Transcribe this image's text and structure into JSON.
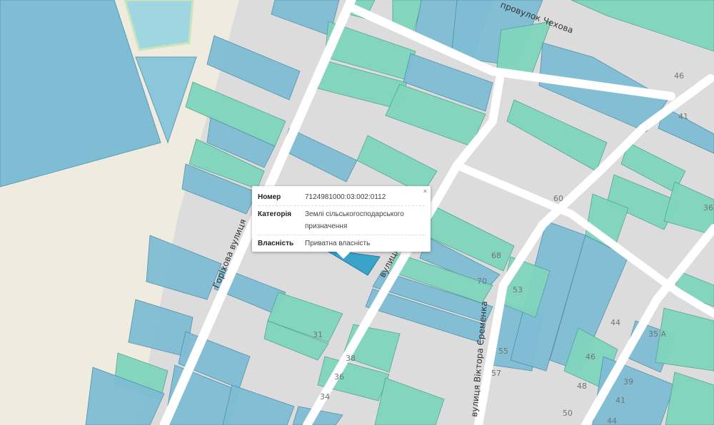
{
  "map": {
    "colors": {
      "background": "#dcdcdc",
      "sand": "#efebdf",
      "parcel_blue": "#7fbdd4",
      "parcel_green": "#80d5bd",
      "selected": "#3aa3c9",
      "road": "#ffffff"
    },
    "streets": {
      "chekhova": "провулок Чехова",
      "horikhova": "Горіхова вулиця",
      "vulytsia": "вулиця",
      "yeremenka": "вулиця Віктора Єременка"
    },
    "house_numbers": [
      "46",
      "41",
      "60",
      "68",
      "70",
      "53",
      "36",
      "44",
      "35 A",
      "55",
      "57",
      "46",
      "48",
      "39",
      "41",
      "50",
      "44",
      "31",
      "38",
      "36",
      "34"
    ]
  },
  "popup": {
    "close_icon": "×",
    "rows": [
      {
        "key": "Номер",
        "value": "7124981000:03:002:0112"
      },
      {
        "key": "Категорія",
        "value": "Землі сільськогосподарського призначення"
      },
      {
        "key": "Власність",
        "value": "Приватна власність"
      }
    ]
  }
}
